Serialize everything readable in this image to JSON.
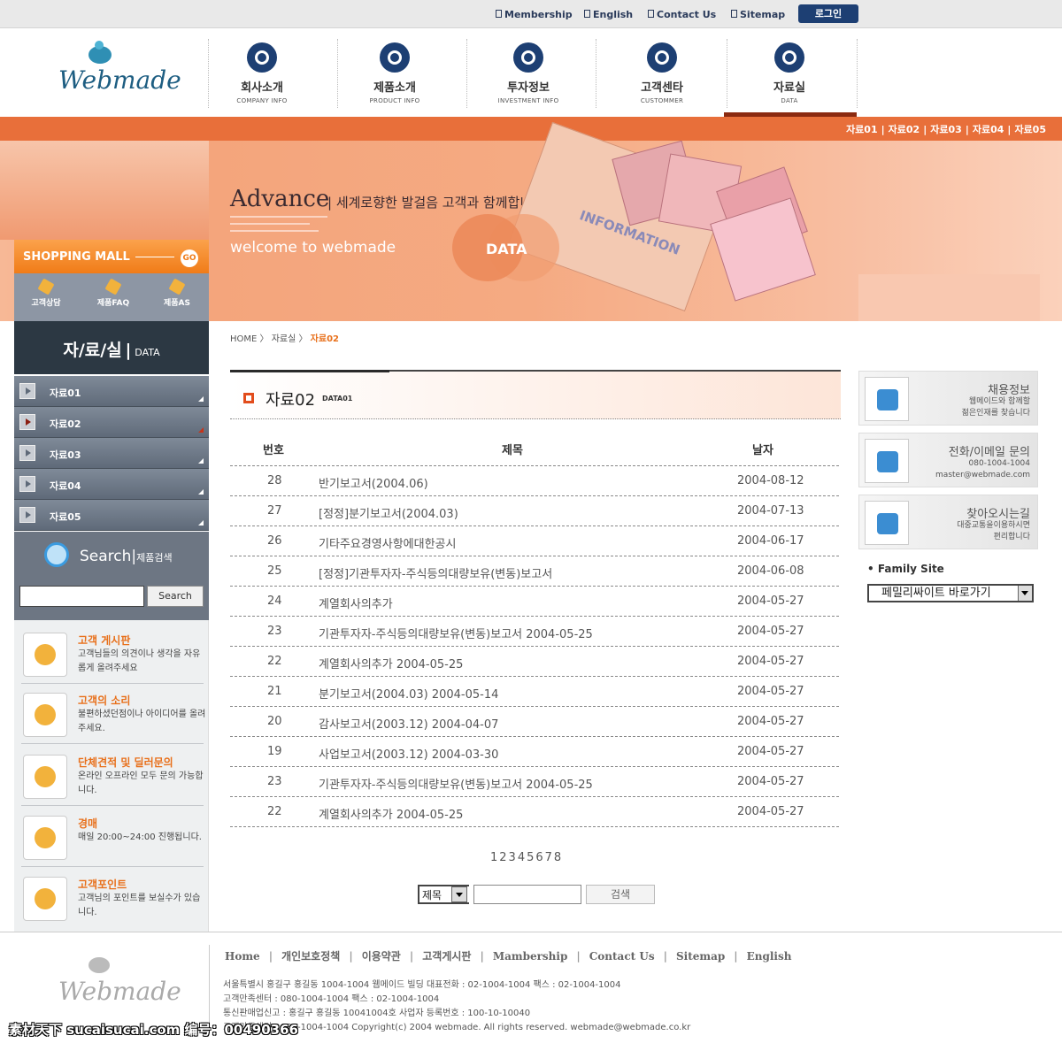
{
  "topbar": {
    "links": [
      "Membership",
      "English",
      "Contact Us",
      "Sitemap"
    ],
    "login": "로그인"
  },
  "logo": "Webmade",
  "nav": [
    {
      "label": "회사소개",
      "sub": "COMPANY INFO"
    },
    {
      "label": "제품소개",
      "sub": "PRODUCT INFO"
    },
    {
      "label": "투자정보",
      "sub": "INVESTMENT INFO"
    },
    {
      "label": "고객센타",
      "sub": "CUSTOMMER"
    },
    {
      "label": "자료실",
      "sub": "DATA"
    }
  ],
  "submenu": [
    "자료01",
    "자료02",
    "자료03",
    "자료04",
    "자료05"
  ],
  "hero": {
    "title": "Advance",
    "tagline": "| 세계로향한 발걸음 고객과 함께합니다.",
    "welcome": "welcome to webmade",
    "data_label": "DATA",
    "card_label": "INFORMATION"
  },
  "shopping": {
    "title": "SHOPPING MALL",
    "go": "GO",
    "items": [
      "고객상담",
      "제품FAQ",
      "제품AS"
    ]
  },
  "section": {
    "title": "자/료/실",
    "sub": "DATA"
  },
  "leftmenu": [
    "자료01",
    "자료02",
    "자료03",
    "자료04",
    "자료05"
  ],
  "search": {
    "title": "Search",
    "sub": "제품검색",
    "button": "Search"
  },
  "features": [
    {
      "title": "고객 게시판",
      "desc": "고객님들의 의견이나 생각을 자유롭게 올려주세요"
    },
    {
      "title": "고객의 소리",
      "desc": "불편하셨던점이나 아이디어를 올려주세요."
    },
    {
      "title": "단체견적 및 딜러문의",
      "desc": "온라인 오프라인 모두 문의 가능합니다."
    },
    {
      "title": "경매",
      "desc": "매일 20:00~24:00 진행됩니다."
    },
    {
      "title": "고객포인트",
      "desc": "고객님의 포인트를 보실수가 있습니다."
    }
  ],
  "breadcrumb": {
    "home": "HOME",
    "mid": "자료실",
    "current": "자료02"
  },
  "board": {
    "title": "자료02",
    "sub": "DATA01",
    "headers": {
      "no": "번호",
      "subject": "제목",
      "date": "날자"
    },
    "rows": [
      {
        "no": "28",
        "subject": "반기보고서(2004.06)",
        "date": "2004-08-12"
      },
      {
        "no": "27",
        "subject": "[정정]분기보고서(2004.03)",
        "date": "2004-07-13"
      },
      {
        "no": "26",
        "subject": "기타주요경영사항에대한공시",
        "date": "2004-06-17"
      },
      {
        "no": "25",
        "subject": "[정정]기관투자자-주식등의대량보유(변동)보고서",
        "date": "2004-06-08"
      },
      {
        "no": "24",
        "subject": "계열회사의추가",
        "date": "2004-05-27"
      },
      {
        "no": "23",
        "subject": "기관투자자-주식등의대량보유(변동)보고서 2004-05-25",
        "date": "2004-05-27"
      },
      {
        "no": "22",
        "subject": "계열회사의추가 2004-05-25",
        "date": "2004-05-27"
      },
      {
        "no": "21",
        "subject": "분기보고서(2004.03) 2004-05-14",
        "date": "2004-05-27"
      },
      {
        "no": "20",
        "subject": "감사보고서(2003.12) 2004-04-07",
        "date": "2004-05-27"
      },
      {
        "no": "19",
        "subject": "사업보고서(2003.12) 2004-03-30",
        "date": "2004-05-27"
      },
      {
        "no": "23",
        "subject": "기관투자자-주식등의대량보유(변동)보고서 2004-05-25",
        "date": "2004-05-27"
      },
      {
        "no": "22",
        "subject": "계열회사의추가 2004-05-25",
        "date": "2004-05-27"
      }
    ],
    "pages": "12345678",
    "search_field": "제목",
    "search_button": "검색"
  },
  "right": [
    {
      "title": "채용정보",
      "desc": "웹메이드와 함께할\n젊은인재를 찾습니다"
    },
    {
      "title": "전화/이메일 문의",
      "desc": "080-1004-1004\nmaster@webmade.com"
    },
    {
      "title": "찾아오시는길",
      "desc": "대중교통을이용하시면\n편리합니다"
    }
  ],
  "family": {
    "label": "Family Site",
    "select": "페밀리싸이트 바로가기"
  },
  "footer": {
    "links": [
      "Home",
      "개인보호정책",
      "이용약관",
      "고객게시판",
      "Mambership",
      "Contact Us",
      "Sitemap",
      "English"
    ],
    "addr1": "서울특별시 홍길구 홍길동 1004-1004 웹메이드 빌딩    대표전화 : 02-1004-1004   팩스 : 02-1004-1004",
    "addr2": "고객만족센터 : 080-1004-1004   팩스 : 02-1004-1004",
    "addr3": "통신판매업신고 : 홍길구 홍길동 10041004호   사업자 등록번호 : 100-10-10040",
    "addr4": "고객만족센터 : 080-1004-1004   Copyright(c) 2004 webmade. All rights reserved. webmade@webmade.co.kr"
  },
  "watermark": "素材天下 sucaisucai.com  编号：00490366"
}
